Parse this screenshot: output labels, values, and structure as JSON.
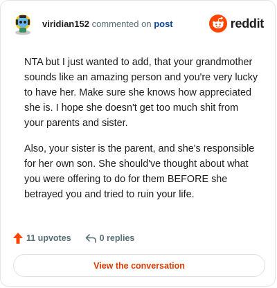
{
  "header": {
    "username": "viridian152",
    "action_text": "commented on",
    "post_link": "post",
    "avatar_icon": "snoo-avatar-icon",
    "brand_icon": "reddit-alien-icon",
    "brand_name": "reddit"
  },
  "comment": {
    "paragraphs": [
      "NTA but I just wanted to add, that your grandmother sounds like an amazing person and you're very lucky to have her. Make sure she knows how appreciated she is. I hope she doesn't get too much shit from your parents and sister.",
      "Also, your sister is the parent, and she's responsible for her own son. She should've thought about what you were offering to do for them BEFORE she betrayed you and tried to ruin your life."
    ]
  },
  "stats": {
    "upvotes": "11 upvotes",
    "replies": "0 replies",
    "upvote_icon": "upvote-arrow-icon",
    "reply_icon": "reply-arrow-icon"
  },
  "cta": {
    "label": "View the conversation"
  },
  "colors": {
    "brand_orange": "#ff4500",
    "link_blue": "#0a449b",
    "muted_gray": "#576f76",
    "cta_text": "#d93a00"
  }
}
